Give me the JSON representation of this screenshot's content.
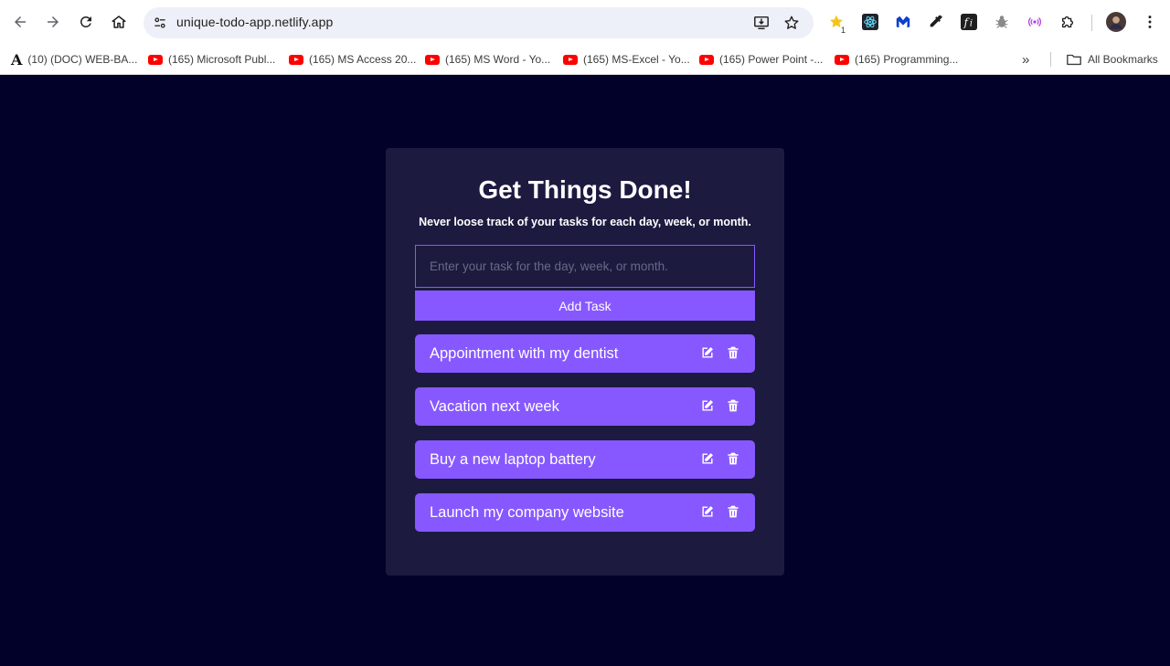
{
  "browser": {
    "url": "unique-todo-app.netlify.app",
    "extension_badge": "1",
    "bookmarks": [
      {
        "label": "(10) (DOC) WEB-BA...",
        "icon": "academia-icon"
      },
      {
        "label": "(165) Microsoft Publ...",
        "icon": "youtube-icon"
      },
      {
        "label": "(165) MS Access 20...",
        "icon": "youtube-icon"
      },
      {
        "label": "(165) MS Word - Yo...",
        "icon": "youtube-icon"
      },
      {
        "label": "(165) MS-Excel - Yo...",
        "icon": "youtube-icon"
      },
      {
        "label": "(165) Power Point -...",
        "icon": "youtube-icon"
      },
      {
        "label": "(165) Programming...",
        "icon": "youtube-icon"
      }
    ],
    "all_bookmarks": "All Bookmarks"
  },
  "app": {
    "title": "Get Things Done!",
    "subtitle": "Never loose track of your tasks for each day, week, or month.",
    "input": {
      "placeholder": "Enter your task for the day, week, or month.",
      "value": ""
    },
    "add_label": "Add Task",
    "tasks": [
      {
        "text": "Appointment with my dentist"
      },
      {
        "text": "Vacation next week"
      },
      {
        "text": "Buy a new laptop battery"
      },
      {
        "text": "Launch my company website"
      }
    ]
  },
  "colors": {
    "page_background": "#01012a",
    "card_background": "#1c1a3f",
    "accent": "#8758ff",
    "text": "#ffffff"
  }
}
